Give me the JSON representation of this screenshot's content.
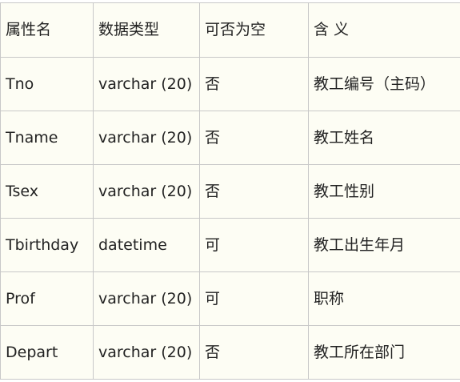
{
  "table": {
    "headers": [
      "属性名",
      "数据类型",
      "可否为空",
      "含 义"
    ],
    "rows": [
      [
        "Tno",
        "varchar (20)",
        "否",
        "教工编号（主码）"
      ],
      [
        "Tname",
        "varchar (20)",
        "否",
        "教工姓名"
      ],
      [
        "Tsex",
        "varchar (20)",
        "否",
        "教工性别"
      ],
      [
        "Tbirthday",
        "datetime",
        "可",
        "教工出生年月"
      ],
      [
        "Prof",
        "varchar (20)",
        "可",
        "职称"
      ],
      [
        "Depart",
        "varchar (20)",
        "否",
        "教工所在部门"
      ]
    ]
  }
}
